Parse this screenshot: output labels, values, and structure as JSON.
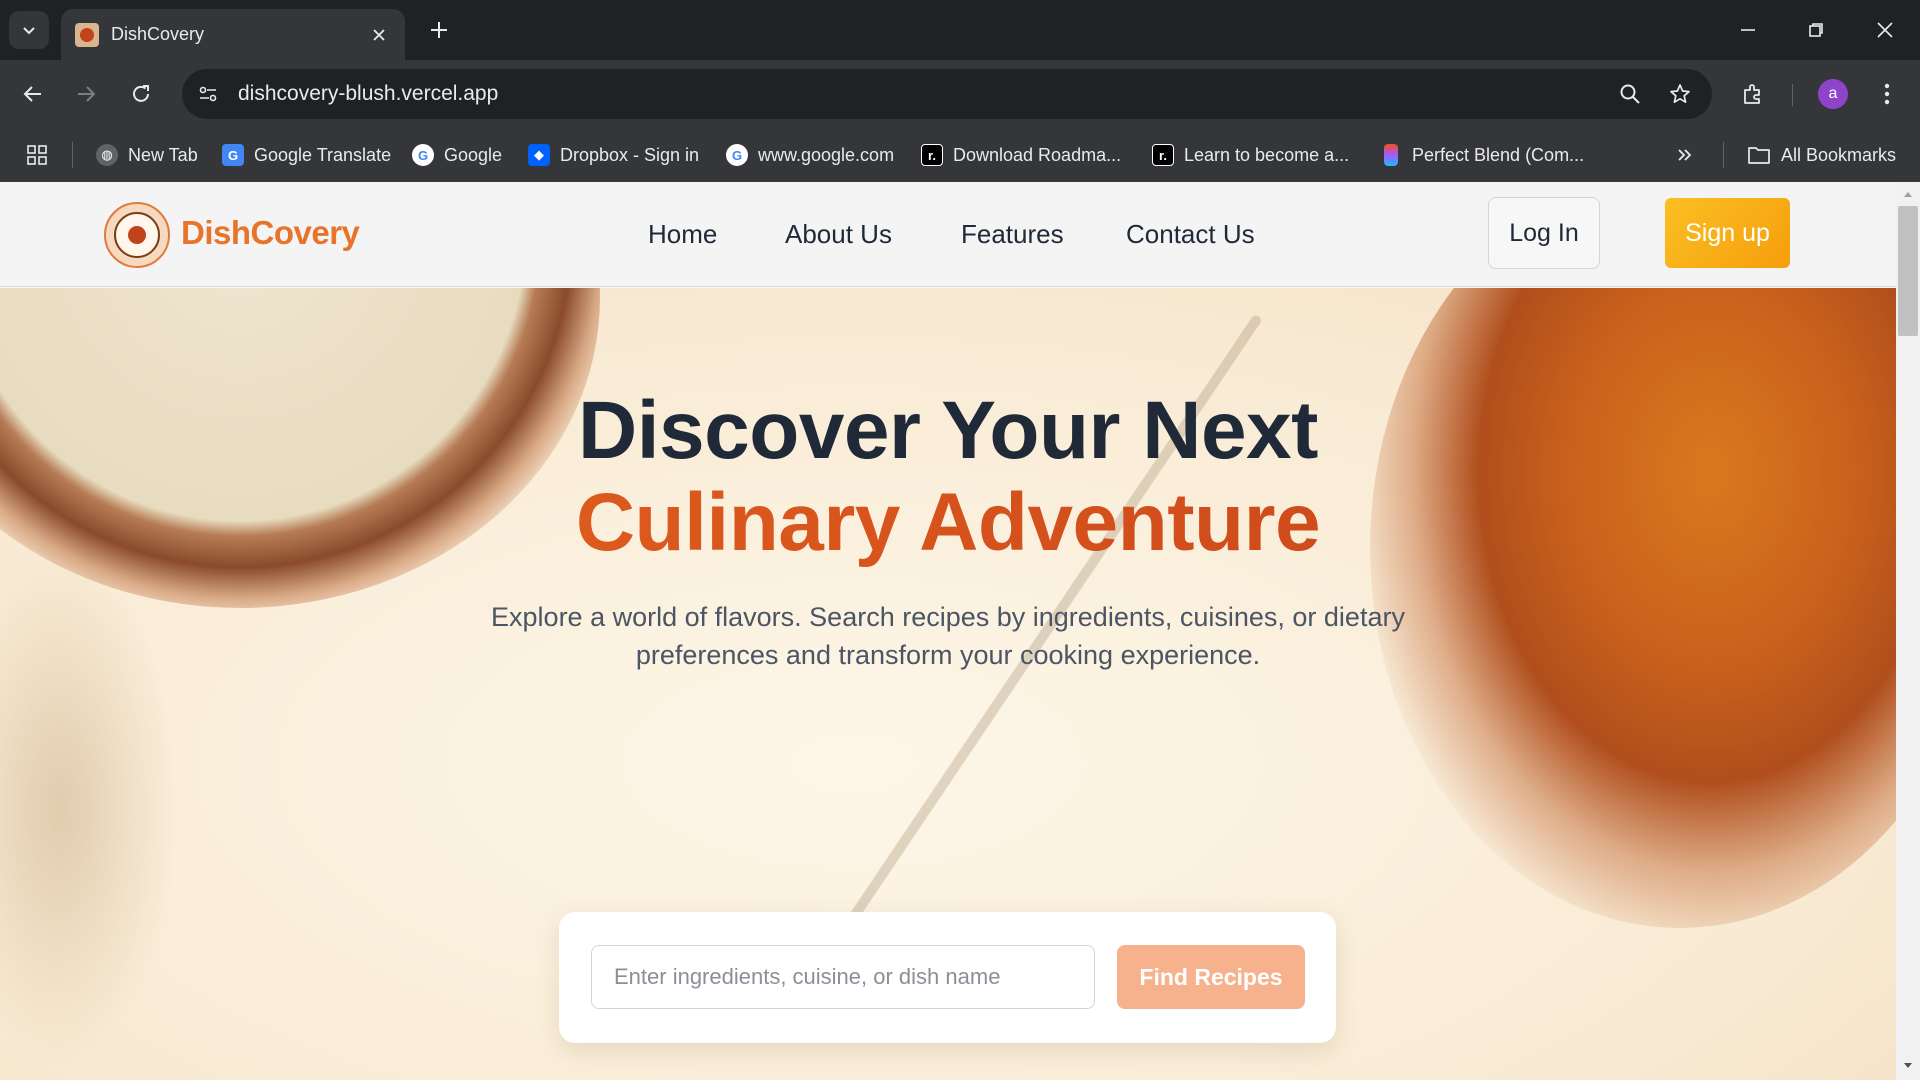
{
  "browser": {
    "tab_title": "DishCovery",
    "url": "dishcovery-blush.vercel.app",
    "profile_initial": "a",
    "bookmarks": [
      {
        "label": "New Tab",
        "icon": "globe-icon"
      },
      {
        "label": "Google Translate",
        "icon": "google-translate-icon"
      },
      {
        "label": "Google",
        "icon": "google-icon"
      },
      {
        "label": "Dropbox - Sign in",
        "icon": "dropbox-icon"
      },
      {
        "label": "www.google.com",
        "icon": "google-icon"
      },
      {
        "label": "Download Roadma...",
        "icon": "roadmap-icon"
      },
      {
        "label": "Learn to become a...",
        "icon": "roadmap-icon"
      },
      {
        "label": "Perfect Blend (Com...",
        "icon": "figma-icon"
      }
    ],
    "all_bookmarks_label": "All Bookmarks"
  },
  "site": {
    "brand": "DishCovery",
    "nav": [
      "Home",
      "About Us",
      "Features",
      "Contact Us"
    ],
    "login_label": "Log In",
    "signup_label": "Sign up"
  },
  "hero": {
    "title_line1": "Discover Your Next",
    "title_line2": "Culinary Adventure",
    "subtitle": "Explore a world of flavors. Search recipes by ingredients, cuisines, or dietary preferences and transform your cooking experience.",
    "search_placeholder": "Enter ingredients, cuisine, or dish name",
    "search_value": "",
    "find_button_label": "Find Recipes"
  },
  "colors": {
    "brand_orange": "#e8742a",
    "signup_yellow": "#fbbf24",
    "find_button": "#f5b28c",
    "title_dark": "#1f2937"
  }
}
